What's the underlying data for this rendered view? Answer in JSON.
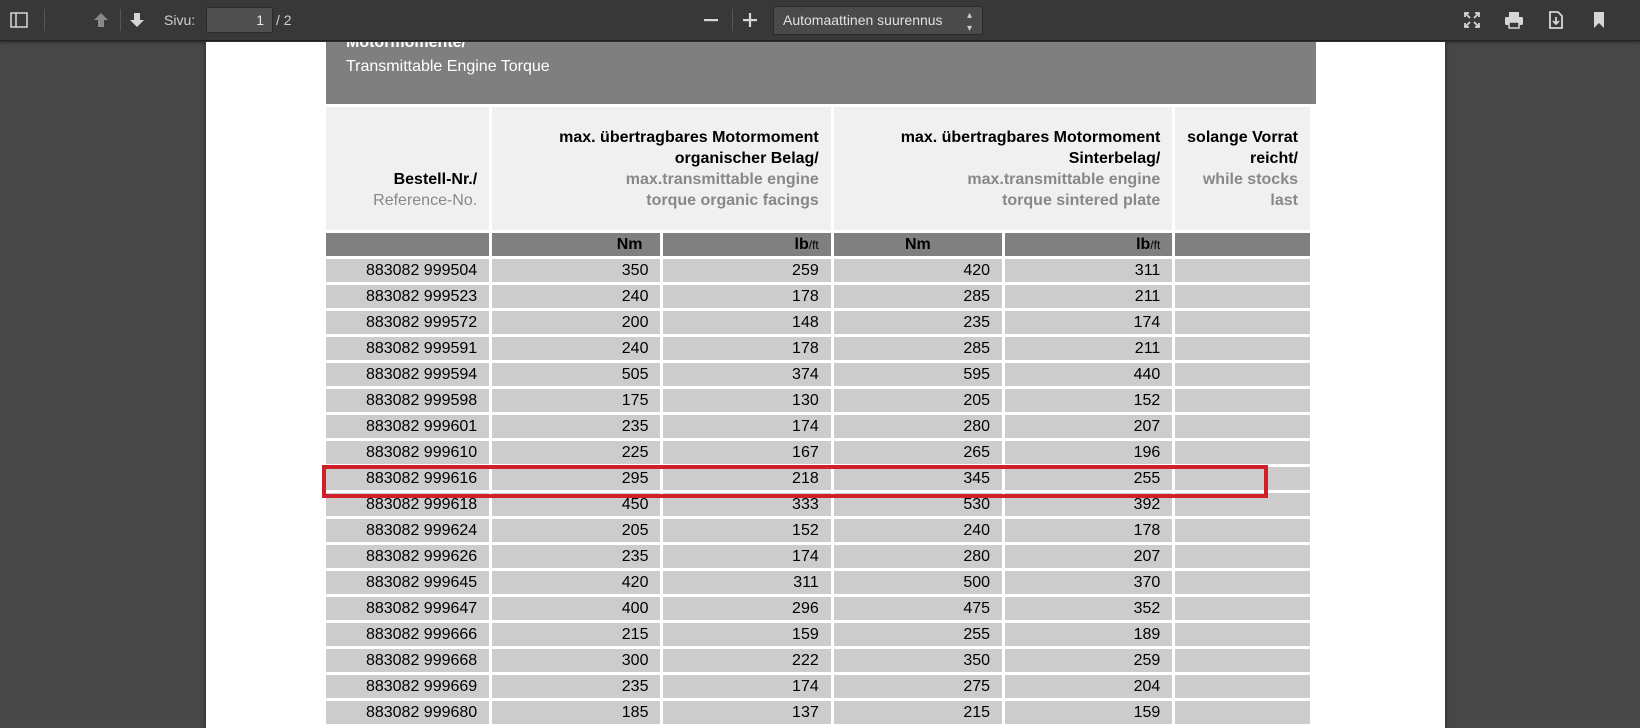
{
  "toolbar": {
    "page_label": "Sivu:",
    "page_value": "1",
    "page_total": "/ 2",
    "zoom_value": "Automaattinen suurennus"
  },
  "section": {
    "title_de": "Motormomente/",
    "title_en": "Transmittable Engine Torque"
  },
  "table": {
    "headers": {
      "ref_de": "Bestell-Nr./",
      "ref_en": "Reference-No.",
      "org_de1": "max. übertragbares Motormoment",
      "org_de2": "organischer Belag/",
      "org_en1": "max.transmittable engine",
      "org_en2": "torque organic facings",
      "sint_de1": "max. übertragbares Motormoment",
      "sint_de2": "Sinterbelag/",
      "sint_en1": "max.transmittable engine",
      "sint_en2": "torque sintered plate",
      "stock_de1": "solange Vorrat",
      "stock_de2": "reicht/",
      "stock_en1": "while stocks",
      "stock_en2": "last"
    },
    "units": {
      "nm": "Nm",
      "lb": "lb",
      "ft": "/ft"
    },
    "rows": [
      [
        "883082 999504",
        "350",
        "259",
        "420",
        "311"
      ],
      [
        "883082 999523",
        "240",
        "178",
        "285",
        "211"
      ],
      [
        "883082 999572",
        "200",
        "148",
        "235",
        "174"
      ],
      [
        "883082 999591",
        "240",
        "178",
        "285",
        "211"
      ],
      [
        "883082 999594",
        "505",
        "374",
        "595",
        "440"
      ],
      [
        "883082 999598",
        "175",
        "130",
        "205",
        "152"
      ],
      [
        "883082 999601",
        "235",
        "174",
        "280",
        "207"
      ],
      [
        "883082 999610",
        "225",
        "167",
        "265",
        "196"
      ],
      [
        "883082 999616",
        "295",
        "218",
        "345",
        "255"
      ],
      [
        "883082 999618",
        "450",
        "333",
        "530",
        "392"
      ],
      [
        "883082 999624",
        "205",
        "152",
        "240",
        "178"
      ],
      [
        "883082 999626",
        "235",
        "174",
        "280",
        "207"
      ],
      [
        "883082 999645",
        "420",
        "311",
        "500",
        "370"
      ],
      [
        "883082 999647",
        "400",
        "296",
        "475",
        "352"
      ],
      [
        "883082 999666",
        "215",
        "159",
        "255",
        "189"
      ],
      [
        "883082 999668",
        "300",
        "222",
        "350",
        "259"
      ],
      [
        "883082 999669",
        "235",
        "174",
        "275",
        "204"
      ],
      [
        "883082 999680",
        "185",
        "137",
        "215",
        "159"
      ]
    ]
  },
  "colors": {
    "highlight": "#d0202a",
    "row_bg": "#cccccc",
    "header_bg": "#7f7f7f"
  }
}
